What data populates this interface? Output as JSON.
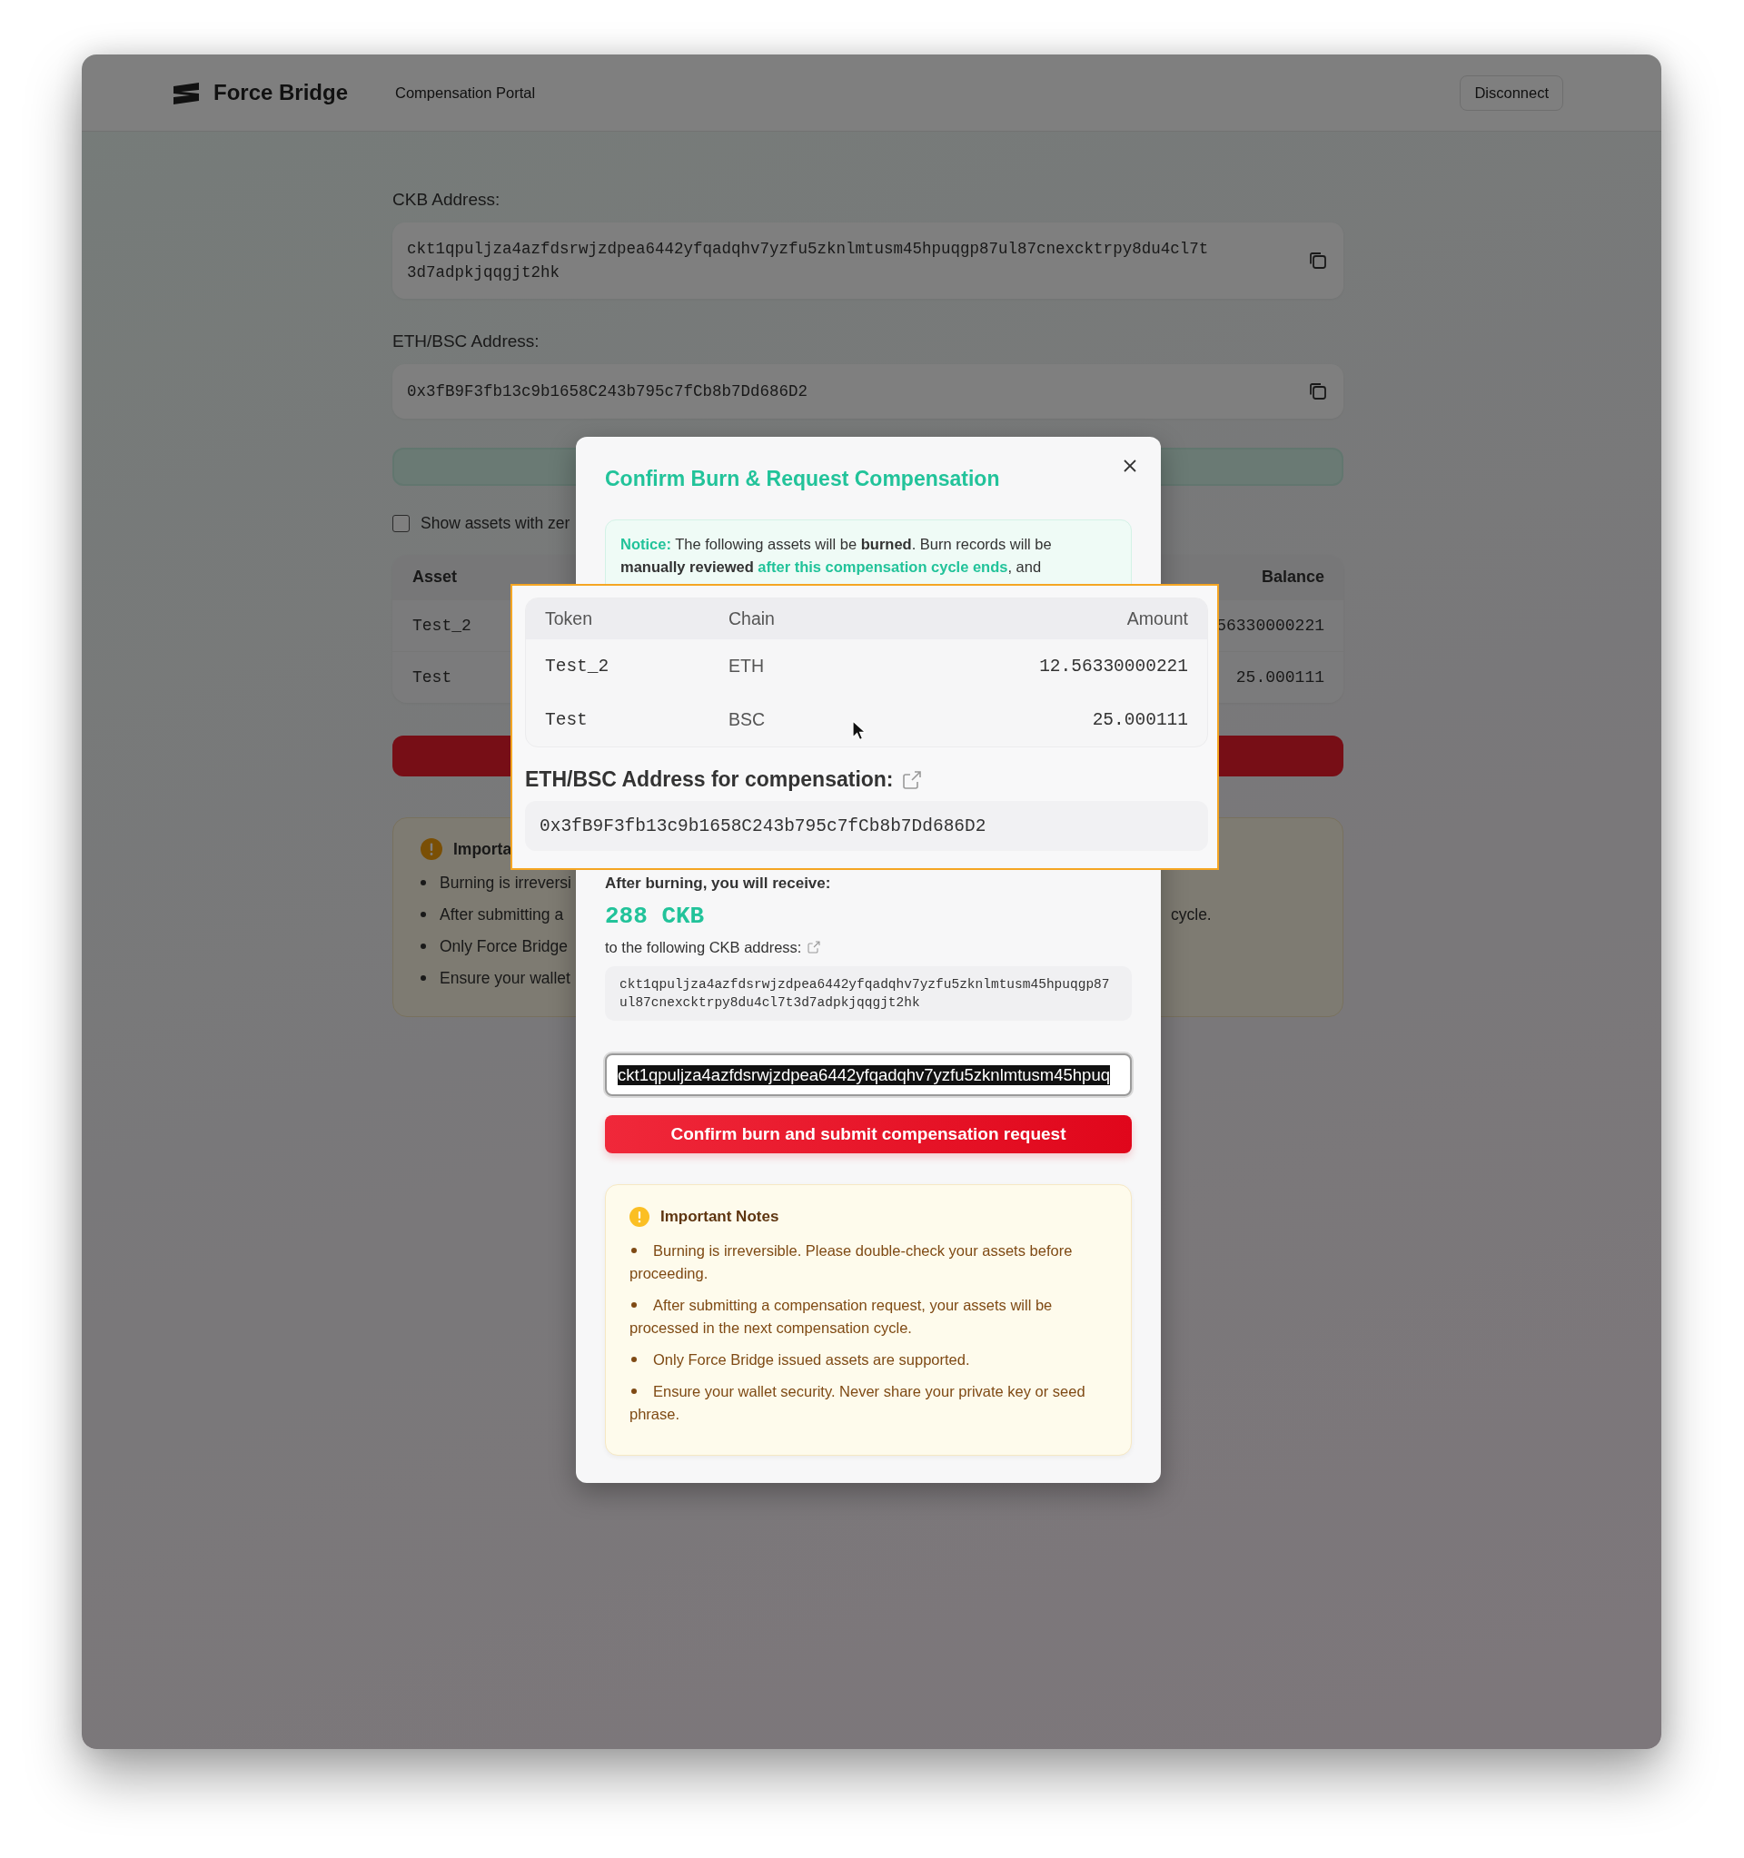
{
  "header": {
    "brand": "Force Bridge",
    "nav_link": "Compensation Portal",
    "disconnect_button": "Disconnect"
  },
  "page": {
    "ckb_address": {
      "label": "CKB Address:",
      "value": "ckt1qpuljza4azfdsrwjzdpea6442yfqadqhv7yzfu5zknlmtusm45hpuqgp87ul87cnexcktrpy8du4cl7t3d7adpkjqqgjt2hk"
    },
    "eth_bsc_address": {
      "label": "ETH/BSC Address:",
      "value": "0x3fB9F3fb13c9b1658C243b795c7fCb8b7Dd686D2"
    },
    "show_zero_assets": {
      "label": "Show assets with zer",
      "checked": false
    },
    "assets_table": {
      "columns": [
        "Asset",
        "Balance"
      ],
      "rows": [
        {
          "asset": "Test_2",
          "balance": "56330000221"
        },
        {
          "asset": "Test",
          "balance": "25.000111"
        }
      ]
    },
    "notes": {
      "title": "Importa",
      "items": [
        {
          "text": "Burning is irreversi"
        },
        {
          "text": "After submitting a",
          "tail": "cycle."
        },
        {
          "text": "Only Force Bridge"
        },
        {
          "text": "Ensure your wallet"
        }
      ]
    }
  },
  "modal": {
    "title": "Confirm Burn & Request Compensation",
    "notice": [
      {
        "kind": "label",
        "text": "Notice:"
      },
      {
        "kind": "plain",
        "text": " The following assets will be **burned**. Burn records will be **manually reviewed** "
      },
      {
        "kind": "highlight",
        "text": "after this compensation cycle ends"
      },
      {
        "kind": "plain",
        "text": ", and"
      }
    ],
    "receive_label": "After burning, you will receive:",
    "receive_amount": "288 CKB",
    "ckb_address_label": "to the following CKB address:",
    "ckb_address": "ckt1qpuljza4azfdsrwjzdpea6442yfqadqhv7yzfu5zknlmtusm45hpuqgp87ul87cnexcktrpy8du4cl7t3d7adpkjqqgjt2hk",
    "confirm_input": {
      "value": "ckt1qpuljza4azfdsrwjzdpea6442yfqadqhv7yzfu5zknlmtusm45hpuq",
      "highlighted": true
    },
    "confirm_button": "Confirm burn and submit compensation request",
    "notes": {
      "title": "Important Notes",
      "items": [
        "Burning is irreversible. Please double-check your assets before proceeding.",
        "After submitting a compensation request, your assets will be processed in the next compensation cycle.",
        "Only Force Bridge issued assets are supported.",
        "Ensure your wallet security. Never share your private key or seed phrase."
      ]
    }
  },
  "zoom_callout": {
    "table": {
      "columns": [
        "Token",
        "Chain",
        "Amount"
      ],
      "rows": [
        {
          "token": "Test_2",
          "chain": "ETH",
          "amount": "12.56330000221"
        },
        {
          "token": "Test",
          "chain": "BSC",
          "amount": "25.000111"
        }
      ]
    },
    "address_label": "ETH/BSC Address for compensation:",
    "address": "0x3fB9F3fb13c9b1658C243b795c7fCb8b7Dd686D2"
  }
}
